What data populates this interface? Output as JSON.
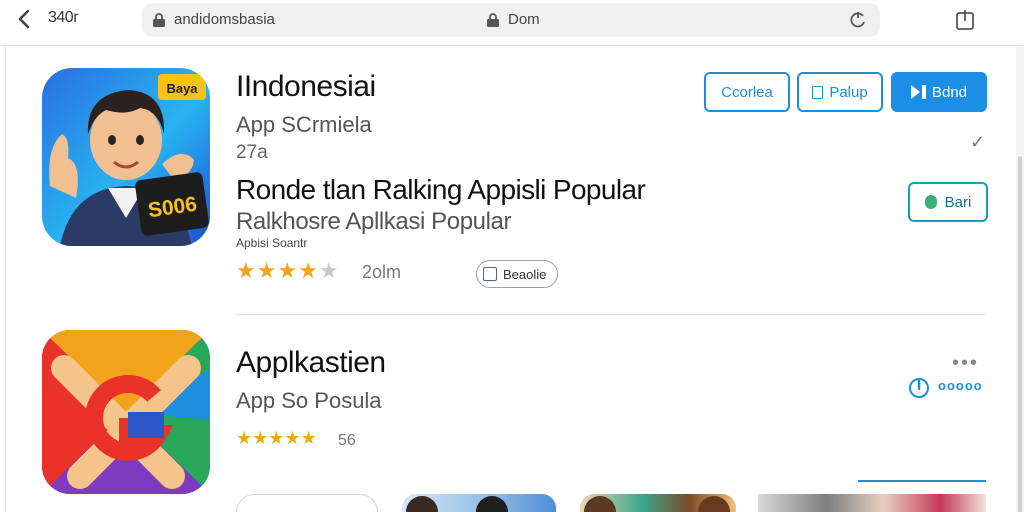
{
  "browser": {
    "time": "340r",
    "url": "andidomsbasia",
    "domain": "Dom"
  },
  "app1": {
    "icon_badge": "Baya",
    "icon_sign": "S006",
    "title": "IIndonesiai",
    "subtitle": "App SCrmiela",
    "count": "27a",
    "headline": "Ronde tlan Ralking Appisli Popular",
    "headline2": "Ralkhosre Apllkasi Popular",
    "caption": "Apbisi Soantr",
    "rating_stars": 4,
    "rating_max": 5,
    "rating_text": "2olm",
    "chip_label": "Beaolie",
    "buttons": {
      "b1": "Ccorlea",
      "b2": "Palup",
      "b3": "Bdnd",
      "b4": "Bari"
    }
  },
  "app2": {
    "title": "Applkastien",
    "subtitle": "App So Posula",
    "rating_stars": 5,
    "rating_text": "56",
    "download_label": "ooooo"
  },
  "colors": {
    "accent": "#1c8fe4",
    "star": "#f2a51a"
  }
}
